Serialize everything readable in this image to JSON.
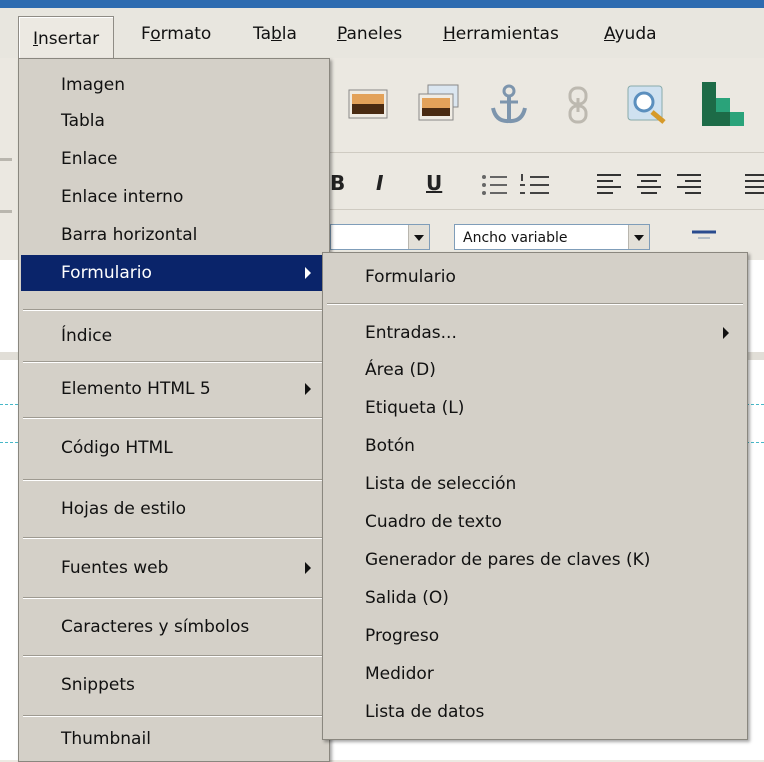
{
  "menubar": {
    "items": [
      {
        "id": "insertar",
        "label": "Insertar",
        "mnemonic": "I"
      },
      {
        "id": "formato",
        "label": "Formato",
        "mnemonic": "o"
      },
      {
        "id": "tabla",
        "label": "Tabla",
        "mnemonic": "b"
      },
      {
        "id": "paneles",
        "label": "Paneles",
        "mnemonic": "P"
      },
      {
        "id": "herramientas",
        "label": "Herramientas",
        "mnemonic": "H"
      },
      {
        "id": "ayuda",
        "label": "Ayuda",
        "mnemonic": "A"
      }
    ]
  },
  "insert_menu": {
    "items": [
      {
        "label": "Imagen"
      },
      {
        "label": "Tabla"
      },
      {
        "label": "Enlace"
      },
      {
        "label": "Enlace interno"
      },
      {
        "label": "Barra horizontal"
      },
      {
        "label": "Formulario",
        "highlighted": true,
        "submenu": true
      },
      {
        "label": "Índice"
      },
      {
        "label": "Elemento HTML 5",
        "submenu": true
      },
      {
        "label": "Código HTML"
      },
      {
        "label": "Hojas de estilo"
      },
      {
        "label": "Fuentes web",
        "submenu": true
      },
      {
        "label": "Caracteres y símbolos"
      },
      {
        "label": "Snippets"
      },
      {
        "label": "Thumbnail"
      }
    ]
  },
  "form_submenu": {
    "items": [
      {
        "label": "Formulario"
      },
      {
        "label": "Entradas...",
        "submenu": true
      },
      {
        "label": "Área (D)"
      },
      {
        "label": "Etiqueta (L)"
      },
      {
        "label": "Botón"
      },
      {
        "label": "Lista de selección"
      },
      {
        "label": "Cuadro de texto"
      },
      {
        "label": "Generador de pares de claves (K)"
      },
      {
        "label": "Salida (O)"
      },
      {
        "label": "Progreso"
      },
      {
        "label": "Medidor"
      },
      {
        "label": "Lista de datos"
      }
    ]
  },
  "toolbar": {
    "width_combo_value": "Ancho variable",
    "format_buttons": [
      {
        "label": "B",
        "icon": "bold-icon"
      },
      {
        "label": "I",
        "icon": "italic-icon"
      },
      {
        "label": "U",
        "icon": "underline-icon"
      }
    ],
    "icons": [
      "image-icon",
      "image-alt-icon",
      "anchor-icon",
      "link-icon",
      "image-edit-icon",
      "table-blocks-icon"
    ]
  },
  "colors": {
    "menu_highlight": "#0a246a",
    "menu_background": "#d4d0c8",
    "guide_line": "#47b8c8"
  }
}
